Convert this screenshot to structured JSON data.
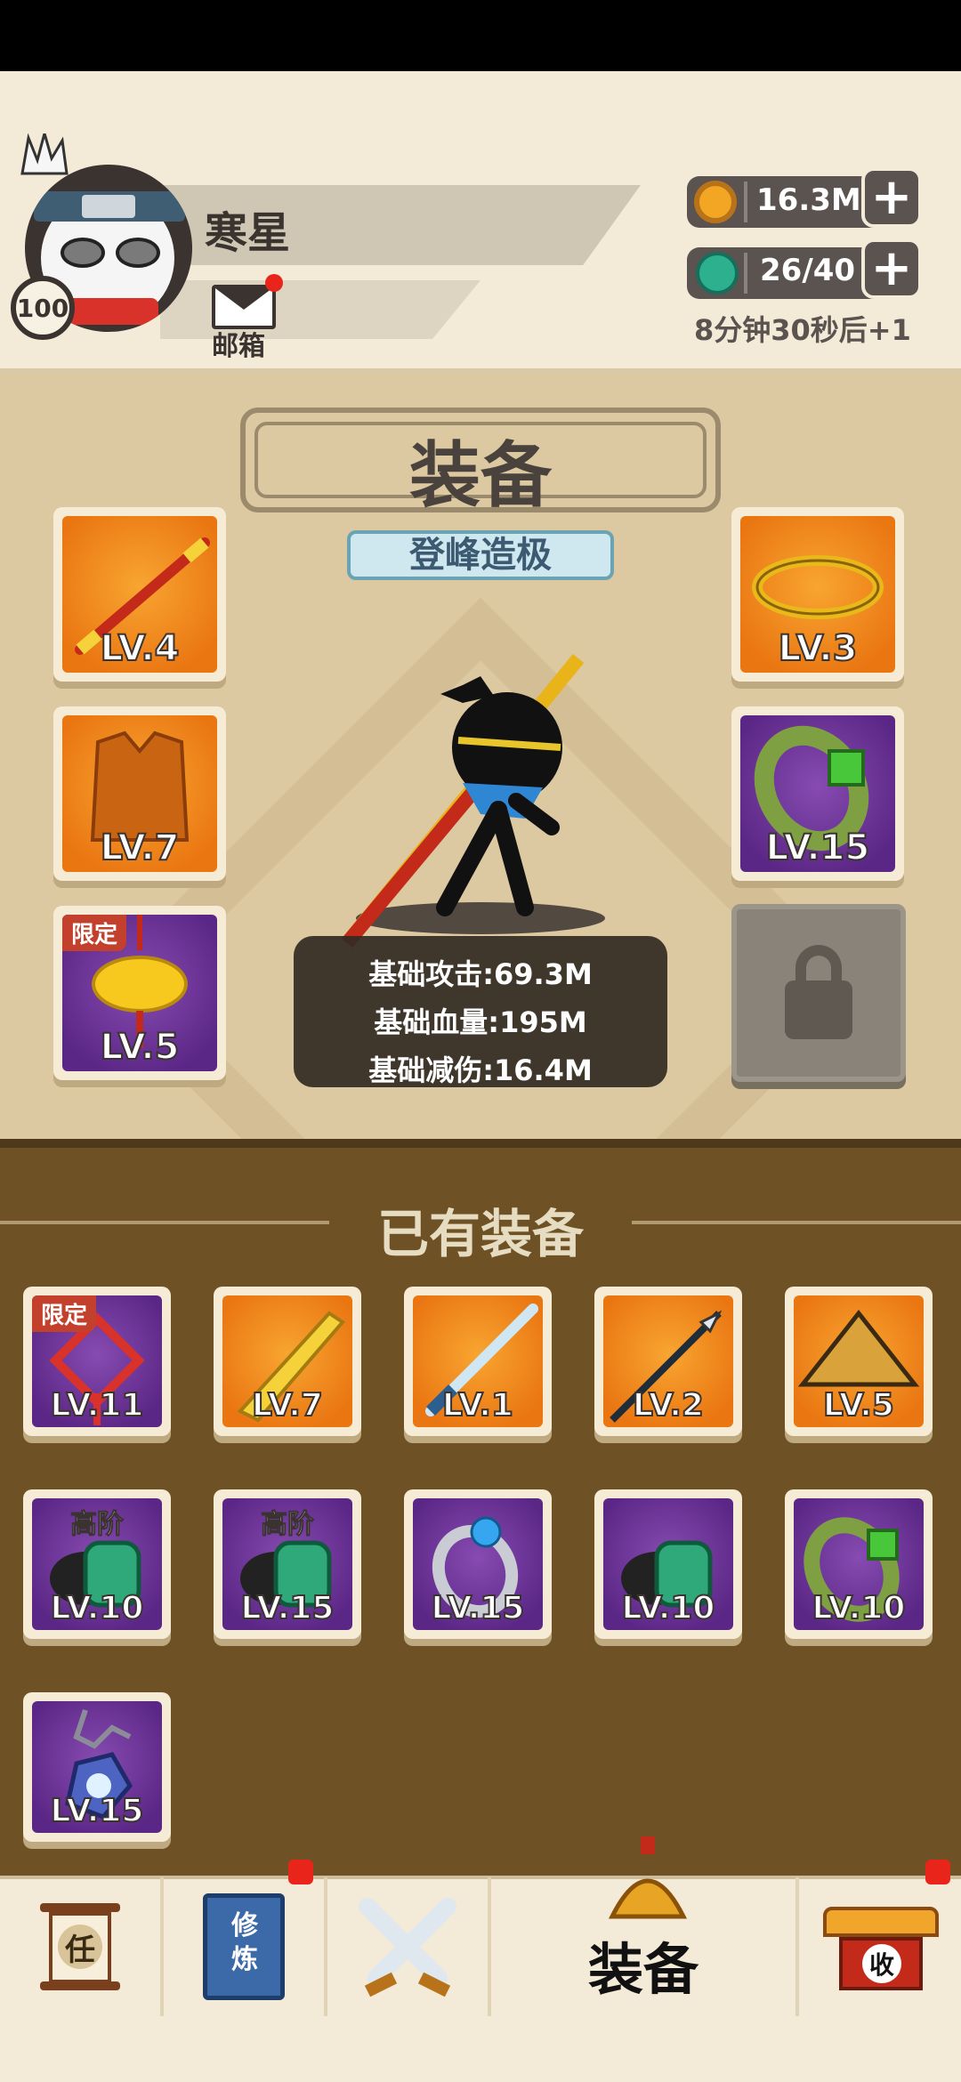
{
  "player": {
    "name": "寒星",
    "level": "100"
  },
  "mail": {
    "label": "邮箱"
  },
  "resources": {
    "coins": "16.3M",
    "energy": "26/40",
    "regen": "8分钟30秒后+1",
    "plus_label": "+"
  },
  "equip": {
    "title": "装备",
    "rank": "登峰造极",
    "slots": [
      {
        "lv": "LV.4"
      },
      {
        "lv": "LV.7"
      },
      {
        "lv": "LV.5",
        "badge": "限定"
      },
      {
        "lv": "LV.3"
      },
      {
        "lv": "LV.15"
      }
    ],
    "stats": [
      "基础攻击:69.3M",
      "基础血量:195M",
      "基础减伤:16.4M"
    ]
  },
  "owned": {
    "title": "已有装备",
    "items": [
      {
        "lv": "LV.11",
        "badge": "限定"
      },
      {
        "lv": "LV.7"
      },
      {
        "lv": "LV.1"
      },
      {
        "lv": "LV.2"
      },
      {
        "lv": "LV.5"
      },
      {
        "lv": "LV.10",
        "tag": "高阶"
      },
      {
        "lv": "LV.15",
        "tag": "高阶"
      },
      {
        "lv": "LV.15"
      },
      {
        "lv": "LV.10"
      },
      {
        "lv": "LV.10"
      },
      {
        "lv": "LV.15"
      }
    ]
  },
  "nav": {
    "task": "任",
    "train_line1": "修",
    "train_line2": "炼",
    "equip": "装备",
    "collect": "收"
  },
  "colors": {
    "orange_slot": "#ea7612",
    "purple_slot": "#5b2786",
    "notify_red": "#e8241b"
  }
}
